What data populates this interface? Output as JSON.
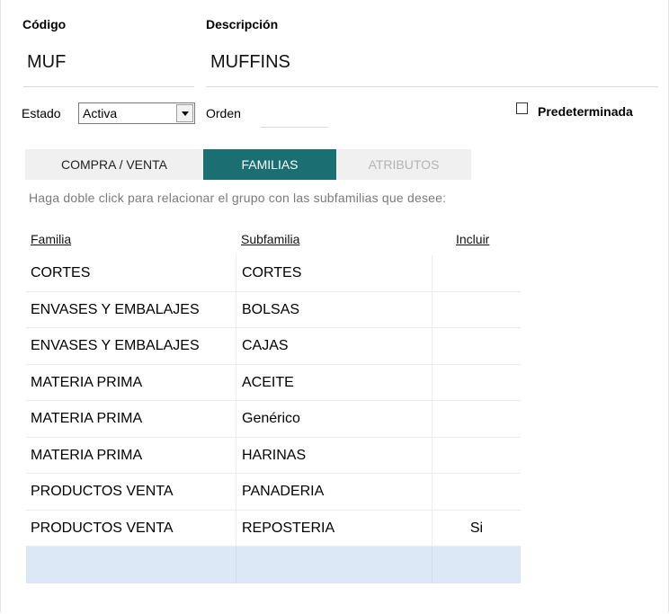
{
  "form": {
    "codigo_label": "Código",
    "codigo_value": "MUF",
    "descripcion_label": "Descripción",
    "descripcion_value": "MUFFINS",
    "estado_label": "Estado",
    "estado_value": "Activa",
    "orden_label": "Orden",
    "orden_value": "",
    "predeterminada_label": "Predeterminada",
    "predeterminada_checked": false
  },
  "tabs": [
    {
      "label": "COMPRA / VENTA",
      "state": "inactive"
    },
    {
      "label": "FAMILIAS",
      "state": "active"
    },
    {
      "label": "ATRIBUTOS",
      "state": "disabled"
    }
  ],
  "hint": "Haga doble click para relacionar el grupo con las subfamilias que desee:",
  "table": {
    "headers": [
      "Familia",
      "Subfamilia",
      "Incluir"
    ],
    "rows": [
      [
        "CORTES",
        "CORTES",
        ""
      ],
      [
        "ENVASES Y EMBALAJES",
        "BOLSAS",
        ""
      ],
      [
        "ENVASES Y EMBALAJES",
        "CAJAS",
        ""
      ],
      [
        "MATERIA PRIMA",
        "ACEITE",
        ""
      ],
      [
        "MATERIA PRIMA",
        "Genérico",
        ""
      ],
      [
        "MATERIA PRIMA",
        "HARINAS",
        ""
      ],
      [
        "PRODUCTOS VENTA",
        "PANADERIA",
        ""
      ],
      [
        "PRODUCTOS VENTA",
        "REPOSTERIA",
        "Si"
      ],
      [
        "",
        "",
        ""
      ]
    ]
  },
  "colors": {
    "active_tab": "#1b6f73",
    "new_row": "#dde8f6",
    "hint_text": "#7a7a7a"
  }
}
